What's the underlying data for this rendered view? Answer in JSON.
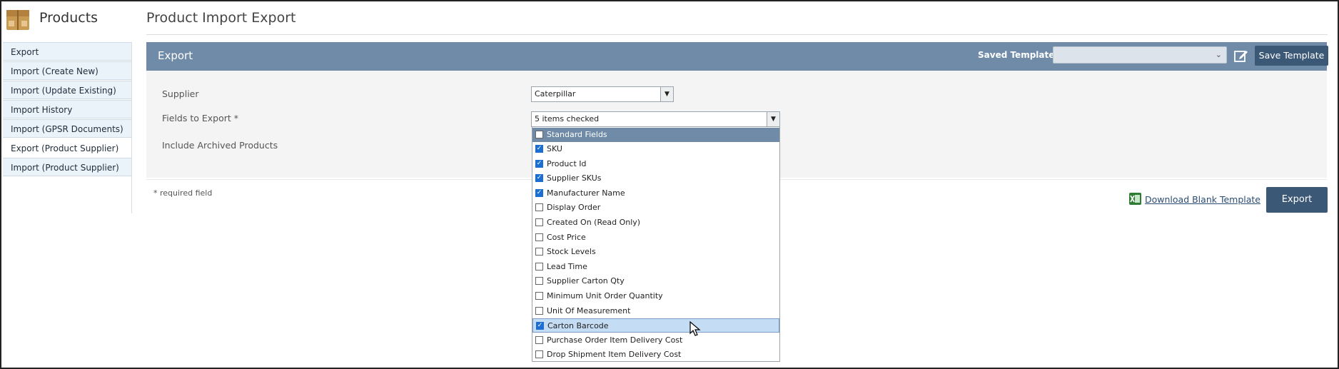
{
  "sidebar": {
    "title": "Products",
    "items": [
      {
        "label": "Export"
      },
      {
        "label": "Import (Create New)"
      },
      {
        "label": "Import (Update Existing)"
      },
      {
        "label": "Import History"
      },
      {
        "label": "Import (GPSR Documents)"
      },
      {
        "label": "Export (Product Supplier)"
      },
      {
        "label": "Import (Product Supplier)"
      }
    ],
    "active_index": 5
  },
  "main": {
    "title": "Product Import Export",
    "panel_title": "Export",
    "saved_templates_label": "Saved Templates:",
    "saved_templates_value": "",
    "save_template_label": "Save Template"
  },
  "form": {
    "supplier_label": "Supplier",
    "supplier_value": "Caterpillar",
    "fields_label": "Fields to Export *",
    "fields_value": "5 items checked",
    "archived_label": "Include Archived Products"
  },
  "dropdown": {
    "group_label": "Standard Fields",
    "options": [
      {
        "label": "SKU",
        "checked": true
      },
      {
        "label": "Product Id",
        "checked": true
      },
      {
        "label": "Supplier SKUs",
        "checked": true
      },
      {
        "label": "Manufacturer Name",
        "checked": true
      },
      {
        "label": "Display Order",
        "checked": false
      },
      {
        "label": "Created On (Read Only)",
        "checked": false
      },
      {
        "label": "Cost Price",
        "checked": false
      },
      {
        "label": "Stock Levels",
        "checked": false
      },
      {
        "label": "Lead Time",
        "checked": false
      },
      {
        "label": "Supplier Carton Qty",
        "checked": false
      },
      {
        "label": "Minimum Unit Order Quantity",
        "checked": false
      },
      {
        "label": "Unit Of Measurement",
        "checked": false
      },
      {
        "label": "Carton Barcode",
        "checked": true
      },
      {
        "label": "Purchase Order Item Delivery Cost",
        "checked": false
      },
      {
        "label": "Drop Shipment Item Delivery Cost",
        "checked": false
      }
    ],
    "highlighted_index": 12
  },
  "footer": {
    "required_note": "* required field",
    "download_label": "Download Blank Template",
    "export_label": "Export"
  },
  "colors": {
    "header_bar": "#6f8ba8",
    "primary_button": "#3c5877",
    "checkbox": "#1c6fd1",
    "sidebar_item_bg": "#eaf2fa"
  },
  "icons": {
    "logo": "product-box-icon",
    "edit": "edit-icon",
    "excel": "excel-icon",
    "cursor": "mouse-pointer-icon"
  }
}
